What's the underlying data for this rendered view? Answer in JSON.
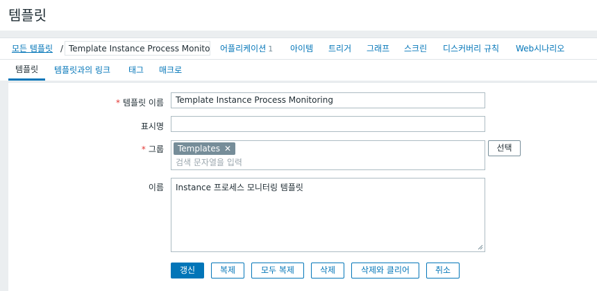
{
  "page": {
    "title": "템플릿"
  },
  "breadcrumb": {
    "all_label": "모든 템플릿",
    "separator": "/",
    "current": "Template Instance Process Monitor..."
  },
  "nav": {
    "items": [
      {
        "label": "어플리케이션",
        "count": "1"
      },
      {
        "label": "아이템"
      },
      {
        "label": "트리거"
      },
      {
        "label": "그래프"
      },
      {
        "label": "스크린"
      },
      {
        "label": "디스커버리 규칙"
      },
      {
        "label": "Web시나리오"
      }
    ]
  },
  "tabs": [
    {
      "label": "템플릿",
      "active": true
    },
    {
      "label": "템플릿과의 링크"
    },
    {
      "label": "태그"
    },
    {
      "label": "매크로"
    }
  ],
  "form": {
    "required_mark": "*",
    "template_name": {
      "label": "템플릿 이름",
      "value": "Template Instance Process Monitoring"
    },
    "visible_name": {
      "label": "표시명",
      "value": ""
    },
    "groups": {
      "label": "그룹",
      "chips": [
        {
          "label": "Templates",
          "remove": "✕"
        }
      ],
      "placeholder": "검색 문자열을 입력",
      "select_label": "선택"
    },
    "description": {
      "label": "이름",
      "value": "Instance 프로세스 모니터링 템플릿"
    }
  },
  "buttons": {
    "update": "갱신",
    "clone": "복제",
    "full_clone": "모두 복제",
    "delete": "삭제",
    "delete_clear": "삭제와 클리어",
    "cancel": "취소"
  },
  "colors": {
    "accent": "#0275b8",
    "required": "#e33734",
    "chip": "#768d99"
  }
}
